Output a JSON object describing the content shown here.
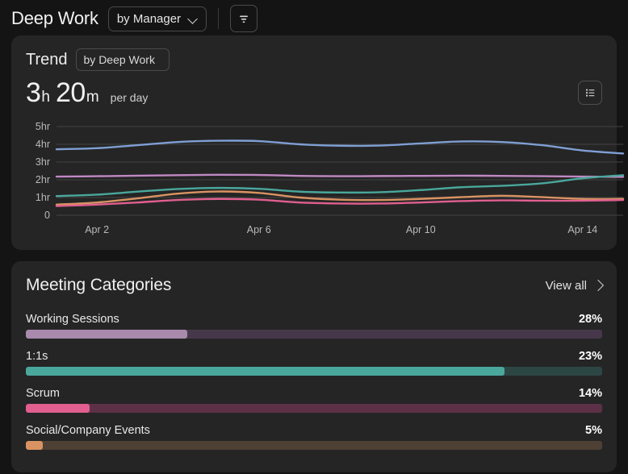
{
  "topbar": {
    "title": "Deep Work",
    "group_by_label": "by Manager",
    "filter_icon": "filter-icon",
    "chevron_icon": "chevron-down-icon"
  },
  "trend": {
    "title": "Trend",
    "breakdown_label": "by Deep Work",
    "value": "3",
    "value_unit": "h",
    "value2": "20",
    "value2_unit": "m",
    "per_label": "per day",
    "list_icon": "list-icon"
  },
  "categories": {
    "title": "Meeting Categories",
    "view_all_label": "View all",
    "chevron_icon": "chevron-right-icon",
    "items": [
      {
        "label": "Working Sessions",
        "pct_label": "28%",
        "pct": 28,
        "color": "#a98aad",
        "track": "#46384a"
      },
      {
        "label": "1:1s",
        "pct_label": "23%",
        "pct": 83,
        "color": "#4aa79c",
        "track": "#2c4644"
      },
      {
        "label": "Scrum",
        "pct_label": "14%",
        "pct": 11,
        "color": "#e05f8f",
        "track": "#5c3147"
      },
      {
        "label": "Social/Company Events",
        "pct_label": "5%",
        "pct": 3,
        "color": "#d99362",
        "track": "#4e4034"
      }
    ]
  },
  "chart_data": {
    "type": "line",
    "title": "Trend",
    "xlabel": "",
    "ylabel": "",
    "ylim": [
      0,
      5
    ],
    "yticks": [
      0,
      1,
      2,
      3,
      4,
      5
    ],
    "ytick_labels": [
      "0",
      "1hr",
      "2hr",
      "3hr",
      "4hr",
      "5hr"
    ],
    "grid": true,
    "legend": "none",
    "xtick_labels": [
      "Apr 2",
      "Apr 6",
      "Apr 10",
      "Apr 14"
    ],
    "xtick_positions": [
      1,
      5,
      9,
      13
    ],
    "x": [
      0,
      1,
      2,
      3,
      4,
      5,
      6,
      7,
      8,
      9,
      10,
      11,
      12,
      13,
      14
    ],
    "series": [
      {
        "name": "series-blue",
        "color": "#7f9fd4",
        "values": [
          3.72,
          3.78,
          3.95,
          4.13,
          4.2,
          4.18,
          4.0,
          3.92,
          3.93,
          4.05,
          4.16,
          4.13,
          3.95,
          3.65,
          3.48
        ]
      },
      {
        "name": "series-purple",
        "color": "#c089c4",
        "values": [
          2.18,
          2.2,
          2.23,
          2.26,
          2.28,
          2.27,
          2.22,
          2.2,
          2.21,
          2.22,
          2.23,
          2.22,
          2.2,
          2.18,
          2.16
        ]
      },
      {
        "name": "series-teal",
        "color": "#4aa79c",
        "values": [
          1.08,
          1.16,
          1.33,
          1.48,
          1.54,
          1.49,
          1.33,
          1.28,
          1.3,
          1.42,
          1.58,
          1.66,
          1.8,
          2.08,
          2.26
        ]
      },
      {
        "name": "series-orange",
        "color": "#d99362",
        "values": [
          0.6,
          0.72,
          0.95,
          1.22,
          1.34,
          1.26,
          1.0,
          0.88,
          0.86,
          0.92,
          1.02,
          1.1,
          1.02,
          0.92,
          0.92
        ]
      },
      {
        "name": "series-pink",
        "color": "#e05f8f",
        "values": [
          0.52,
          0.6,
          0.72,
          0.86,
          0.92,
          0.88,
          0.72,
          0.66,
          0.66,
          0.72,
          0.8,
          0.84,
          0.82,
          0.82,
          0.86
        ]
      }
    ]
  }
}
